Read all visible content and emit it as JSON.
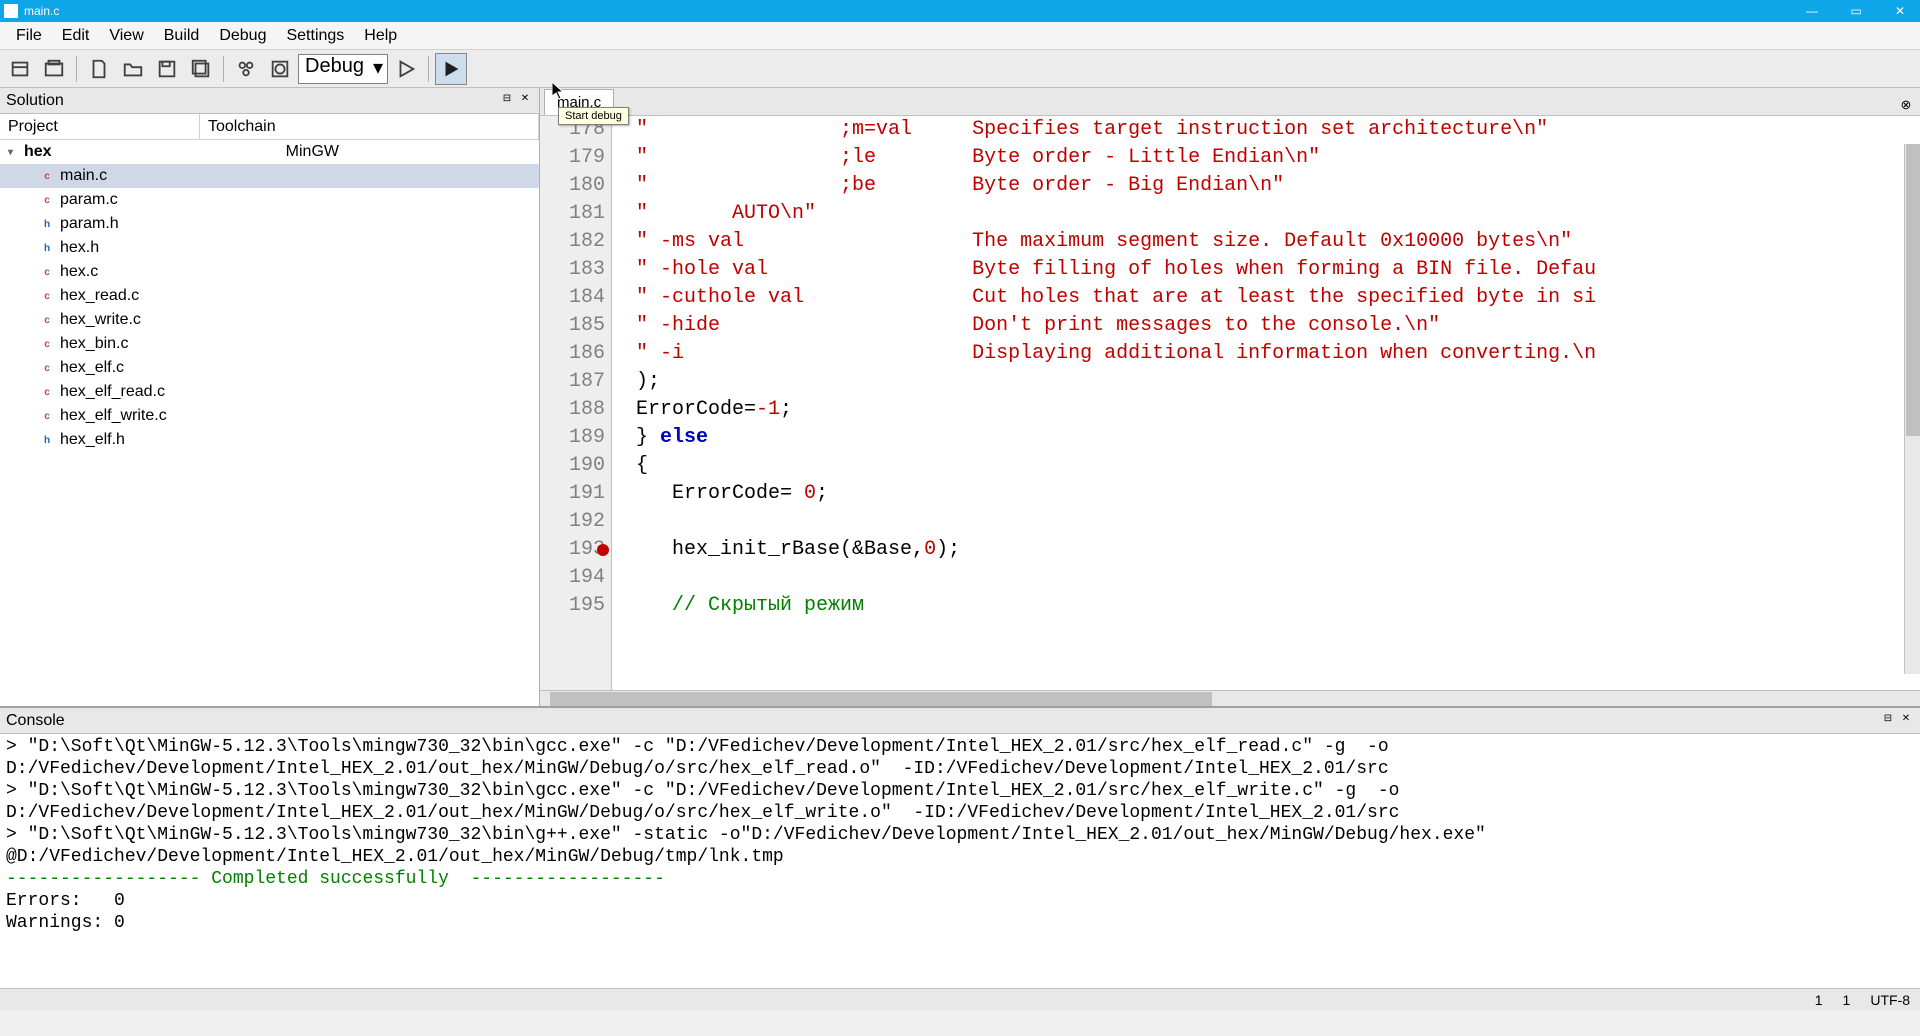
{
  "title": "main.c",
  "menu": [
    "File",
    "Edit",
    "View",
    "Build",
    "Debug",
    "Settings",
    "Help"
  ],
  "config": "Debug",
  "tooltip": "Start debug",
  "solution": {
    "panel_title": "Solution",
    "col_project": "Project",
    "col_toolchain": "Toolchain",
    "root": "hex",
    "toolchain": "MinGW",
    "files": [
      {
        "name": "main.c",
        "type": "c",
        "selected": true
      },
      {
        "name": "param.c",
        "type": "c"
      },
      {
        "name": "param.h",
        "type": "h"
      },
      {
        "name": "hex.h",
        "type": "h"
      },
      {
        "name": "hex.c",
        "type": "c"
      },
      {
        "name": "hex_read.c",
        "type": "c"
      },
      {
        "name": "hex_write.c",
        "type": "c"
      },
      {
        "name": "hex_bin.c",
        "type": "c"
      },
      {
        "name": "hex_elf.c",
        "type": "c"
      },
      {
        "name": "hex_elf_read.c",
        "type": "c"
      },
      {
        "name": "hex_elf_write.c",
        "type": "c"
      },
      {
        "name": "hex_elf.h",
        "type": "h"
      }
    ]
  },
  "editor": {
    "tab": "main.c",
    "lines": [
      {
        "n": 178,
        "t": "string",
        "text": "\"                ;m=val     Specifies target instruction set architecture\\n\""
      },
      {
        "n": 179,
        "t": "string",
        "text": "\"                ;le        Byte order - Little Endian\\n\""
      },
      {
        "n": 180,
        "t": "string",
        "text": "\"                ;be        Byte order - Big Endian\\n\""
      },
      {
        "n": 181,
        "t": "string",
        "text": "\"       AUTO\\n\""
      },
      {
        "n": 182,
        "t": "string",
        "text": "\" -ms val                   The maximum segment size. Default 0x10000 bytes\\n\""
      },
      {
        "n": 183,
        "t": "string",
        "text": "\" -hole val                 Byte filling of holes when forming a BIN file. Defau"
      },
      {
        "n": 184,
        "t": "string",
        "text": "\" -cuthole val              Cut holes that are at least the specified byte in si"
      },
      {
        "n": 185,
        "t": "string",
        "text": "\" -hide                     Don't print messages to the console.\\n\""
      },
      {
        "n": 186,
        "t": "string",
        "text": "\" -i                        Displaying additional information when converting.\\n"
      },
      {
        "n": 187,
        "t": "code",
        "html": ");"
      },
      {
        "n": 188,
        "t": "code",
        "html": "ErrorCode=<span class='s-num'>-1</span>;"
      },
      {
        "n": 189,
        "t": "code",
        "html": "} <span class='s-kw'>else</span>"
      },
      {
        "n": 190,
        "t": "code",
        "html": "{"
      },
      {
        "n": 191,
        "t": "code",
        "html": "   ErrorCode= <span class='s-num'>0</span>;"
      },
      {
        "n": 192,
        "t": "code",
        "html": ""
      },
      {
        "n": 193,
        "t": "code",
        "bp": true,
        "html": "   hex_init_rBase(&amp;Base,<span class='s-num'>0</span>);"
      },
      {
        "n": 194,
        "t": "code",
        "html": ""
      },
      {
        "n": 195,
        "t": "code",
        "html": "   <span class='s-comment'>// Скрытый режим</span>"
      }
    ]
  },
  "console": {
    "panel_title": "Console",
    "lines": [
      "> \"D:\\Soft\\Qt\\MinGW-5.12.3\\Tools\\mingw730_32\\bin\\gcc.exe\" -c \"D:/VFedichev/Development/Intel_HEX_2.01/src/hex_elf_read.c\" -g  -o",
      "D:/VFedichev/Development/Intel_HEX_2.01/out_hex/MinGW/Debug/o/src/hex_elf_read.o\"  -ID:/VFedichev/Development/Intel_HEX_2.01/src",
      "",
      "> \"D:\\Soft\\Qt\\MinGW-5.12.3\\Tools\\mingw730_32\\bin\\gcc.exe\" -c \"D:/VFedichev/Development/Intel_HEX_2.01/src/hex_elf_write.c\" -g  -o",
      "D:/VFedichev/Development/Intel_HEX_2.01/out_hex/MinGW/Debug/o/src/hex_elf_write.o\"  -ID:/VFedichev/Development/Intel_HEX_2.01/src",
      "",
      "> \"D:\\Soft\\Qt\\MinGW-5.12.3\\Tools\\mingw730_32\\bin\\g++.exe\" -static -o\"D:/VFedichev/Development/Intel_HEX_2.01/out_hex/MinGW/Debug/hex.exe\"",
      "@D:/VFedichev/Development/Intel_HEX_2.01/out_hex/MinGW/Debug/tmp/lnk.tmp",
      ""
    ],
    "completed_prefix": "------------------ ",
    "completed_text": "Completed successfully",
    "completed_suffix": "  ------------------",
    "errors_label": "Errors:   0",
    "warnings_label": "Warnings: 0"
  },
  "status": {
    "line": "1",
    "col": "1",
    "encoding": "UTF-8"
  }
}
